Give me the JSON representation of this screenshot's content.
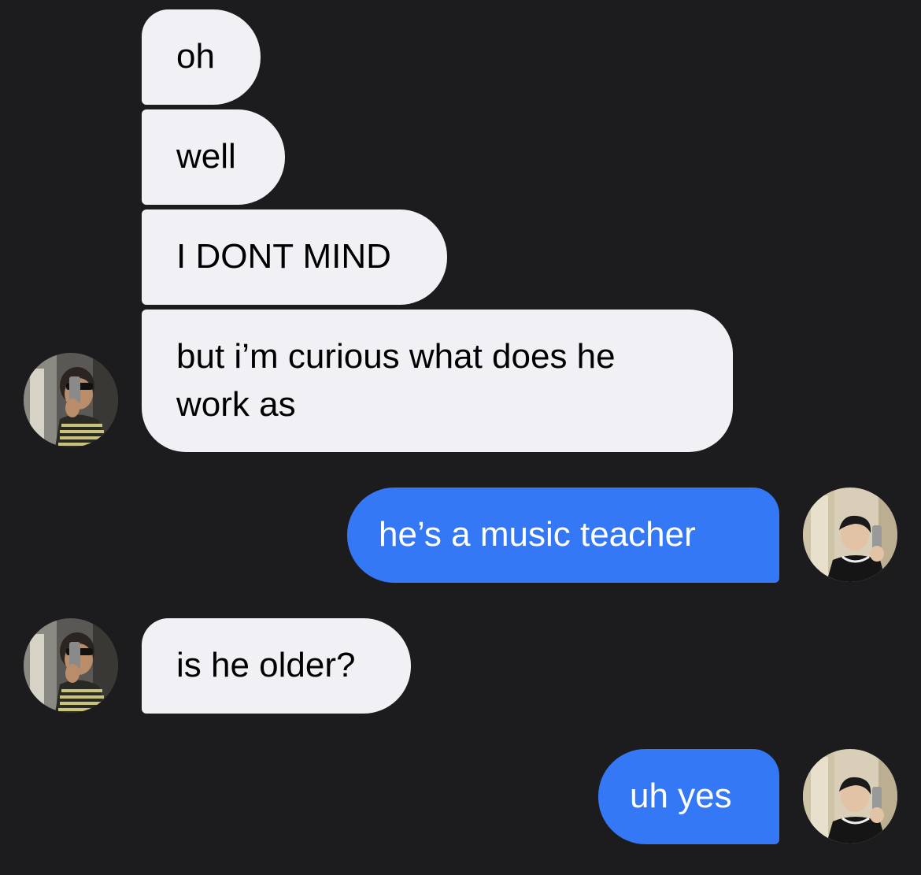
{
  "conversation": {
    "messages": [
      {
        "sender": "them",
        "text": "oh"
      },
      {
        "sender": "them",
        "text": "well"
      },
      {
        "sender": "them",
        "text": "I DONT MIND"
      },
      {
        "sender": "them",
        "text": "but i’m curious what does he work as"
      },
      {
        "sender": "me",
        "text": "he’s a music teacher"
      },
      {
        "sender": "them",
        "text": "is he older?"
      },
      {
        "sender": "me",
        "text": "uh yes"
      }
    ]
  },
  "colors": {
    "background": "#1c1c1e",
    "incoming_bubble": "#f0f0f5",
    "outgoing_bubble": "#3478f6"
  },
  "icons": {
    "contact_avatar": "contact-avatar-photo",
    "user_avatar": "user-avatar-photo"
  }
}
